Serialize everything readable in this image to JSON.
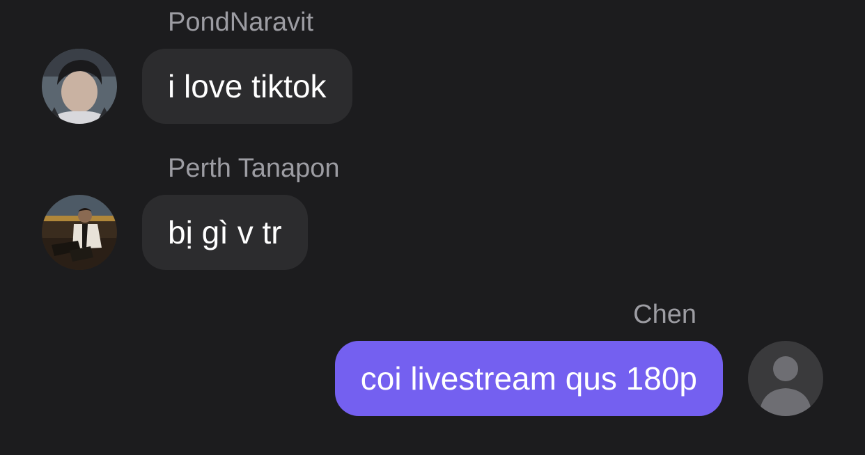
{
  "messages": [
    {
      "sender": "PondNaravit",
      "text": "i love tiktok",
      "direction": "incoming",
      "avatar_icon": "user-photo-avatar"
    },
    {
      "sender": "Perth Tanapon",
      "text": "bị gì v tr",
      "direction": "incoming",
      "avatar_icon": "user-photo-avatar"
    },
    {
      "sender": "Chen",
      "text": "coi livestream qus 180p",
      "direction": "outgoing",
      "avatar_icon": "default-person-avatar-icon"
    }
  ],
  "colors": {
    "background": "#1c1c1e",
    "incoming_bubble": "#2c2c2e",
    "outgoing_bubble": "#7460f0",
    "sender_name": "#9d9da3",
    "message_text": "#ffffff"
  }
}
